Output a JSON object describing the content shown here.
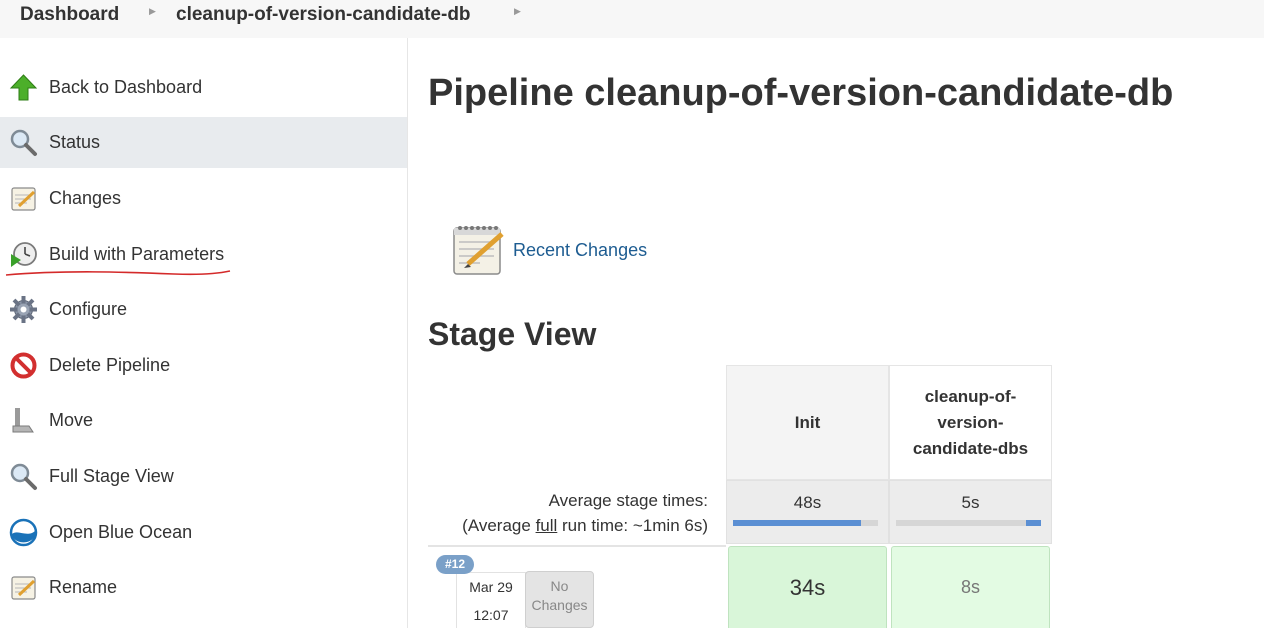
{
  "breadcrumb": {
    "items": [
      "Dashboard",
      "cleanup-of-version-candidate-db"
    ]
  },
  "sidebar": {
    "items": [
      {
        "label": "Back to Dashboard",
        "icon": "up-arrow-icon"
      },
      {
        "label": "Status",
        "icon": "magnifier-icon"
      },
      {
        "label": "Changes",
        "icon": "notepad-icon"
      },
      {
        "label": "Build with Parameters",
        "icon": "clock-play-icon"
      },
      {
        "label": "Configure",
        "icon": "gear-icon"
      },
      {
        "label": "Delete Pipeline",
        "icon": "no-entry-icon"
      },
      {
        "label": "Move",
        "icon": "move-icon"
      },
      {
        "label": "Full Stage View",
        "icon": "magnifier-icon"
      },
      {
        "label": "Open Blue Ocean",
        "icon": "blue-ocean-icon"
      },
      {
        "label": "Rename",
        "icon": "notepad-icon"
      }
    ]
  },
  "main": {
    "title": "Pipeline cleanup-of-version-candidate-db",
    "recent_changes": "Recent Changes",
    "stage_view_title": "Stage View"
  },
  "stage_view": {
    "columns": [
      "Init",
      "cleanup-of-version-candidate-dbs"
    ],
    "column_lines": [
      [
        "Init"
      ],
      [
        "cleanup-of-",
        "version-",
        "candidate-dbs"
      ]
    ],
    "avg_label": "Average stage times:",
    "avg_full_prefix": "(Average ",
    "avg_full_link": "full",
    "avg_full_suffix": " run time: ~1min 6s)",
    "avg_times": [
      "48s",
      "5s"
    ],
    "avg_progress": [
      0.88,
      0.1
    ],
    "builds": [
      {
        "badge": "#12",
        "date": "Mar 29",
        "time": "12:07",
        "changes": "No Changes",
        "stage_times": [
          "34s",
          "8s"
        ]
      }
    ]
  },
  "colors": {
    "link": "#1d5c91",
    "success_cell": "#d9f6d9",
    "progress": "#5b8fd3",
    "annotation": "#d42a2a"
  }
}
